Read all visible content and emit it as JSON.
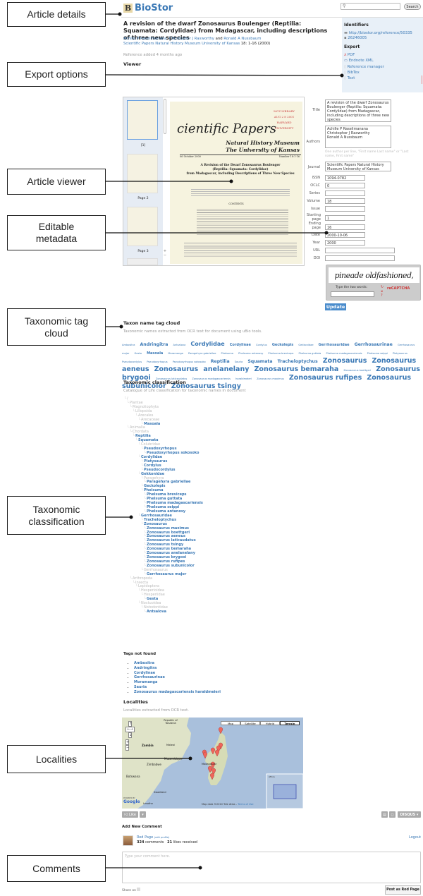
{
  "header": {
    "logo_letter": "B",
    "site_name": "BioStor",
    "search_placeholder": "",
    "search_button": "Search"
  },
  "article": {
    "title": "A revision of the dwarf Zonosaurus Boulenger (Reptilia: Squamata: Cordylidae) from Madagascar, including descriptions of three new species",
    "authors": [
      "Achille P Raselimanana",
      "Christopher J Raxworthy",
      "Ronald A Nussbaum"
    ],
    "authors_sep": ", ",
    "authors_and": " and ",
    "journal": "Scientific Papers Natural History Museum University of Kansas",
    "citation": " 18: 1-16 (2000)",
    "added": "Reference added 4 months ago",
    "viewer_heading": "Viewer"
  },
  "sidebar": {
    "identifiers_heading": "Identifiers",
    "identifiers": [
      {
        "icon": "link-icon",
        "label": "http://biostor.org/reference/50335"
      },
      {
        "icon": "bhl-icon",
        "label": "26246005"
      }
    ],
    "export_heading": "Export",
    "exports": [
      {
        "icon": "pdf-icon",
        "label": "PDF"
      },
      {
        "icon": "xml-icon",
        "label": "Endnote XML"
      },
      {
        "icon": "document-icon",
        "label": "Reference manager"
      },
      {
        "icon": "document-icon",
        "label": "BibTex"
      },
      {
        "icon": "text-icon",
        "label": "Text"
      }
    ]
  },
  "viewer": {
    "thumbnails": [
      "[1]",
      "Page 2",
      "Page 3"
    ],
    "page": {
      "masthead": "cientific Papers",
      "museum1": "Natural History Museum",
      "museum2": "The University of Kansas",
      "date": "06 October 2000",
      "number": "Number 18:1-16",
      "heading1": "A Revision of the Dwarf Zonosaurus Boulenger",
      "heading2": "(Reptilia: Squamata: Cordylidae)",
      "heading3": "from Madagascar, including Descriptions of Three New Species",
      "contents": "CONTENTS",
      "stamp": "MCZ LIBRARY  AUG 2 8 2001  HARVARD UNIVERSITY"
    }
  },
  "metadata": {
    "title_label": "Title",
    "title": "A revision of the dwarf Zonosaurus Boulenger (Reptilia: Squamata: Cordylidae) from Madagascar, including descriptions of three new species",
    "authors_label": "Authors",
    "authors": "Achille P Raselimanana\nChristopher J Raxworthy\nRonald A Nussbaum",
    "authors_hint": "One author per line, \"First name Last name\" or \"Last name, First name\"",
    "journal_label": "Journal",
    "journal": "Scientific Papers Natural History Museum University of Kansas",
    "issn_label": "ISSN",
    "issn": "1094-0782",
    "oclc_label": "OCLC",
    "oclc": "0",
    "series_label": "Series",
    "series": "",
    "volume_label": "Volume",
    "volume": "18",
    "issue_label": "Issue",
    "issue": "",
    "spage_label": "Starting page",
    "spage": "1",
    "epage_label": "Ending page",
    "epage": "16",
    "date_label": "Date",
    "date": "2000-10-06",
    "year_label": "Year",
    "year": "2000",
    "url_label": "URL",
    "url": "",
    "doi_label": "DOI",
    "doi": "",
    "captcha_words": "pineade oldfashioned,",
    "captcha_prompt": "Type the two words:",
    "captcha_brand": "reCAPTCHA",
    "update_button": "Update"
  },
  "tagcloud": {
    "heading": "Taxon name tag cloud",
    "subtitle": "Taxonomic names extracted from OCR text for document using uBio tools.",
    "tags": [
      {
        "t": "Ambositra",
        "s": 1
      },
      {
        "t": "Andringitra",
        "s": 3
      },
      {
        "t": "Antsalova",
        "s": 1
      },
      {
        "t": "Cordylidae",
        "s": 4
      },
      {
        "t": "Cordylinae",
        "s": 2
      },
      {
        "t": "Cordylus",
        "s": 1
      },
      {
        "t": "Geckolepis",
        "s": 2
      },
      {
        "t": "Gekkonidae",
        "s": 1
      },
      {
        "t": "Gerrhosauridae",
        "s": 2
      },
      {
        "t": "Gerrhosaurinae",
        "s": 3
      },
      {
        "t": "Gerrhosaurus major",
        "s": 1
      },
      {
        "t": "Gesta",
        "s": 1
      },
      {
        "t": "Masoala",
        "s": 2
      },
      {
        "t": "Moramanga",
        "s": 1
      },
      {
        "t": "Paragehyra gabriellae",
        "s": 1
      },
      {
        "t": "Phelsuma",
        "s": 1
      },
      {
        "t": "Phelsuma antanosy",
        "s": 1
      },
      {
        "t": "Phelsuma breviceps",
        "s": 1
      },
      {
        "t": "Phelsuma guttata",
        "s": 1
      },
      {
        "t": "Phelsuma madagascariensis",
        "s": 1
      },
      {
        "t": "Phelsuma seippi",
        "s": 1
      },
      {
        "t": "Platysaurus",
        "s": 1
      },
      {
        "t": "Pseudocordylus",
        "s": 1
      },
      {
        "t": "Pseudoxyrhopus",
        "s": 1
      },
      {
        "t": "Pseudoxyrhopus sokosoko",
        "s": 1
      },
      {
        "t": "Reptilia",
        "s": 3
      },
      {
        "t": "Sauria",
        "s": 1
      },
      {
        "t": "Squamata",
        "s": 3
      },
      {
        "t": "Tracheloptychus",
        "s": 3
      },
      {
        "t": "Zonosaurus",
        "s": 5
      },
      {
        "t": "Zonosaurus aeneus",
        "s": 5
      },
      {
        "t": "Zonosaurus",
        "s": 5
      },
      {
        "t": "anelanelany",
        "s": 5
      },
      {
        "t": "Zonosaurus bemaraha",
        "s": 5
      },
      {
        "t": "Zonosaurus boettgeri",
        "s": 1
      },
      {
        "t": "Zonosaurus brygooi",
        "s": 5
      },
      {
        "t": "Zonosaurus laticaudatus",
        "s": 1
      },
      {
        "t": "Zonosaurus madagascariensis",
        "s": 1
      },
      {
        "t": "haraldmeieri",
        "s": 1
      },
      {
        "t": "Zonosaurus maximus",
        "s": 1
      },
      {
        "t": "Zonosaurus rufipes",
        "s": 5
      },
      {
        "t": "Zonosaurus subunicolor",
        "s": 5
      },
      {
        "t": "Zonosaurus tsingy",
        "s": 5
      }
    ]
  },
  "classification": {
    "heading": "Taxonomic classification",
    "subtitle": "Catalogue of Life classification for taxonomic names in document",
    "tree": [
      {
        "d": 0,
        "n": "/",
        "f": false
      },
      {
        "d": 1,
        "n": "Plantae",
        "f": false
      },
      {
        "d": 2,
        "n": "Magnoliophyta",
        "f": false
      },
      {
        "d": 3,
        "n": "Liliopsida",
        "f": false
      },
      {
        "d": 4,
        "n": "Arecales",
        "f": false
      },
      {
        "d": 5,
        "n": "Arecaceae",
        "f": false
      },
      {
        "d": 6,
        "n": "Masoala",
        "f": true
      },
      {
        "d": 1,
        "n": "Animalia",
        "f": false
      },
      {
        "d": 2,
        "n": "Chordata",
        "f": false
      },
      {
        "d": 3,
        "n": "Reptilia",
        "f": true
      },
      {
        "d": 4,
        "n": "Squamata",
        "f": true
      },
      {
        "d": 5,
        "n": "Colubridae",
        "f": false
      },
      {
        "d": 6,
        "n": "Pseudoxyrhopus",
        "f": true
      },
      {
        "d": 7,
        "n": "Pseudoxyrhopus sokosoko",
        "f": true
      },
      {
        "d": 5,
        "n": "Cordylidae",
        "f": true
      },
      {
        "d": 6,
        "n": "Platysaurus",
        "f": true
      },
      {
        "d": 6,
        "n": "Cordylus",
        "f": true
      },
      {
        "d": 6,
        "n": "Pseudocordylus",
        "f": true
      },
      {
        "d": 5,
        "n": "Gekkonidae",
        "f": true
      },
      {
        "d": 6,
        "n": "Paragehyra",
        "f": false
      },
      {
        "d": 7,
        "n": "Paragehyra gabriellae",
        "f": true
      },
      {
        "d": 6,
        "n": "Geckolepis",
        "f": true
      },
      {
        "d": 6,
        "n": "Phelsuma",
        "f": true
      },
      {
        "d": 7,
        "n": "Phelsuma breviceps",
        "f": true
      },
      {
        "d": 7,
        "n": "Phelsuma guttata",
        "f": true
      },
      {
        "d": 7,
        "n": "Phelsuma madagascariensis",
        "f": true
      },
      {
        "d": 7,
        "n": "Phelsuma seippi",
        "f": true
      },
      {
        "d": 7,
        "n": "Phelsuma antanosy",
        "f": true
      },
      {
        "d": 5,
        "n": "Gerrhosauridae",
        "f": true
      },
      {
        "d": 6,
        "n": "Tracheloptychus",
        "f": true
      },
      {
        "d": 6,
        "n": "Zonosaurus",
        "f": true
      },
      {
        "d": 7,
        "n": "Zonosaurus maximus",
        "f": true
      },
      {
        "d": 7,
        "n": "Zonosaurus boettgeri",
        "f": true
      },
      {
        "d": 7,
        "n": "Zonosaurus aeneus",
        "f": true
      },
      {
        "d": 7,
        "n": "Zonosaurus laticaudatus",
        "f": true
      },
      {
        "d": 7,
        "n": "Zonosaurus tsingy",
        "f": true
      },
      {
        "d": 7,
        "n": "Zonosaurus bemaraha",
        "f": true
      },
      {
        "d": 7,
        "n": "Zonosaurus anelanelany",
        "f": true
      },
      {
        "d": 7,
        "n": "Zonosaurus brygooi",
        "f": true
      },
      {
        "d": 7,
        "n": "Zonosaurus rufipes",
        "f": true
      },
      {
        "d": 7,
        "n": "Zonosaurus subunicolor",
        "f": true
      },
      {
        "d": 6,
        "n": "Gerrhosaurus",
        "f": false
      },
      {
        "d": 7,
        "n": "Gerrhosaurus major",
        "f": true
      },
      {
        "d": 2,
        "n": "Arthropoda",
        "f": false
      },
      {
        "d": 3,
        "n": "Insecta",
        "f": false
      },
      {
        "d": 4,
        "n": "Lepidoptera",
        "f": false
      },
      {
        "d": 5,
        "n": "Hesperioidea",
        "f": false
      },
      {
        "d": 6,
        "n": "Hesperiidae",
        "f": false
      },
      {
        "d": 7,
        "n": "Gesta",
        "f": true
      },
      {
        "d": 5,
        "n": "Noctuoidea",
        "f": false
      },
      {
        "d": 6,
        "n": "Notodontidae",
        "f": false
      },
      {
        "d": 7,
        "n": "Antsalova",
        "f": true
      }
    ]
  },
  "not_found": {
    "heading": "Tags not found",
    "items": [
      "Ambositra",
      "Andringitra",
      "Cordylinae",
      "Gerrhosaurinae",
      "Moramanga",
      "Sauria",
      "Zonosaurus madagascariensis haraldmeieri"
    ]
  },
  "localities": {
    "heading": "Localities",
    "subtitle": "Localities extracted from OCR text.",
    "map": {
      "types": [
        "Map",
        "Satellite",
        "Hybrid",
        "Terrain"
      ],
      "selected": "Terrain",
      "labels": {
        "tanzania": "Republic of Tanzania",
        "zambia": "Zambia",
        "malawi": "Malawi",
        "mozambique": "Mozambique",
        "zimbabwe": "Zimbabwe",
        "botswana": "Botswana",
        "madagascar": "Madagascar",
        "swaziland": "Swaziland",
        "lesotho": "Lesotho",
        "africa": "Africa"
      },
      "attribution": "Map data ©2010 Tele Atlas - ",
      "terms": "Terms of Use",
      "powered": "POWERED BY",
      "google": "Google",
      "colors": {
        "sea": "#a9c0dc",
        "land": "#dfe3c8",
        "pin": "#f0655a"
      }
    }
  },
  "comments": {
    "like": "Like",
    "disqus": "DISQUS",
    "heading": "Add New Comment",
    "user": "Rod Page",
    "edit_profile": "(edit profile)",
    "comment_count": "324",
    "comments_label": " comments",
    "likes_count": "21",
    "likes_label": " likes received",
    "logout": "Logout",
    "placeholder": "Type your comment here.",
    "share_on": "Share on",
    "post_button": "Post as Rod Page"
  },
  "callouts": [
    "Article details",
    "Export options",
    "Article viewer",
    "Editable metadata",
    "Taxonomic tag cloud",
    "Taxonomic classification",
    "Localities",
    "Comments"
  ]
}
